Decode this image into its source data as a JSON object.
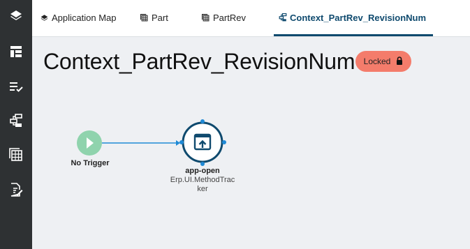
{
  "sidebar": {
    "items": [
      {
        "icon": "layers-icon"
      },
      {
        "icon": "layout-icon"
      },
      {
        "icon": "checklist-icon"
      },
      {
        "icon": "hierarchy-icon"
      },
      {
        "icon": "grid-table-icon"
      },
      {
        "icon": "edit-document-icon"
      }
    ]
  },
  "tabs": [
    {
      "label": "Application Map",
      "icon": "layers-icon"
    },
    {
      "label": "Part",
      "icon": "table-icon"
    },
    {
      "label": "PartRev",
      "icon": "table-icon"
    },
    {
      "label": "Context_PartRev_RevisionNum",
      "icon": "hierarchy-icon",
      "active": true
    }
  ],
  "page": {
    "title": "Context_PartRev_RevisionNum",
    "status_badge": "Locked",
    "status_color": "#f47c6b"
  },
  "flow": {
    "trigger": {
      "label": "No Trigger",
      "color": "#8fd3ad"
    },
    "action": {
      "name": "app-open",
      "type_line1": "Erp.UI.MethodTrac",
      "type_line2": "ker"
    },
    "accent": "#0f4a6e",
    "connector_color": "#1f8ad6"
  }
}
